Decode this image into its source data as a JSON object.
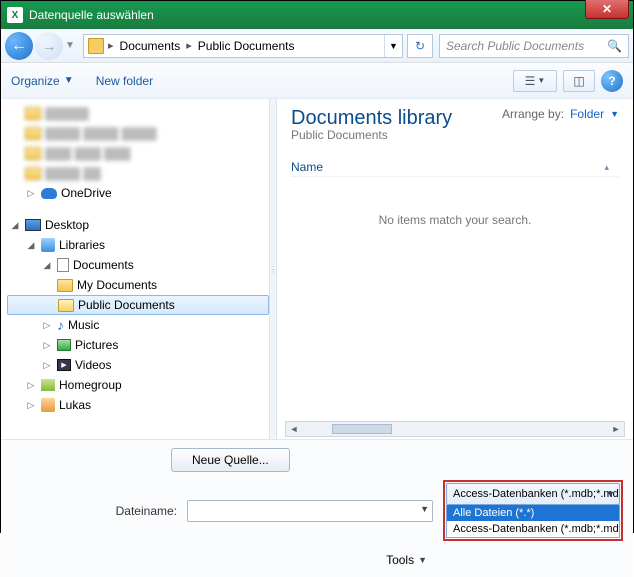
{
  "window": {
    "title": "Datenquelle auswählen",
    "app_icon_text": "X"
  },
  "breadcrumb": {
    "items": [
      "Documents",
      "Public Documents"
    ]
  },
  "search": {
    "placeholder": "Search Public Documents"
  },
  "toolbar": {
    "organize": "Organize",
    "new_folder": "New folder"
  },
  "tree": {
    "blurred": [
      "▓▓▓▓▓",
      "▓▓▓▓ ▓▓▓▓ ▓▓▓▓",
      "▓▓▓ ▓▓▓ ▓▓▓",
      "▓▓▓▓ ▓▓"
    ],
    "onedrive": "OneDrive",
    "desktop": "Desktop",
    "libraries": "Libraries",
    "documents": "Documents",
    "my_documents": "My Documents",
    "public_documents": "Public Documents",
    "music": "Music",
    "pictures": "Pictures",
    "videos": "Videos",
    "homegroup": "Homegroup",
    "user": "Lukas"
  },
  "content": {
    "library_title": "Documents library",
    "library_sub": "Public Documents",
    "arrange_label": "Arrange by:",
    "arrange_value": "Folder",
    "column_name": "Name",
    "empty_message": "No items match your search."
  },
  "bottom": {
    "new_source": "Neue Quelle...",
    "filename_label": "Dateiname:",
    "filename_value": "",
    "tools_label": "Tools",
    "type_selected": "Access-Datenbanken (*.mdb;*.mde;*.accdb)",
    "type_options": [
      "Alle Dateien (*.*)",
      "Access-Datenbanken (*.mdb;*.mde;*.accdb)"
    ]
  }
}
